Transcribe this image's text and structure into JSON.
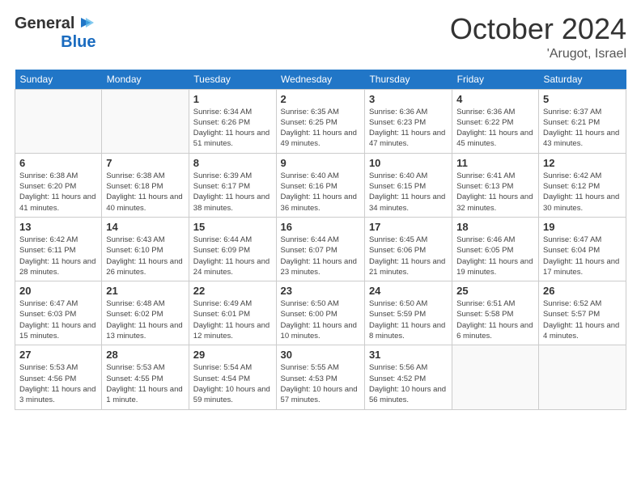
{
  "header": {
    "logo_general": "General",
    "logo_blue": "Blue",
    "month": "October 2024",
    "location": "'Arugot, Israel"
  },
  "days_of_week": [
    "Sunday",
    "Monday",
    "Tuesday",
    "Wednesday",
    "Thursday",
    "Friday",
    "Saturday"
  ],
  "weeks": [
    [
      {
        "day": "",
        "info": ""
      },
      {
        "day": "",
        "info": ""
      },
      {
        "day": "1",
        "info": "Sunrise: 6:34 AM\nSunset: 6:26 PM\nDaylight: 11 hours and 51 minutes."
      },
      {
        "day": "2",
        "info": "Sunrise: 6:35 AM\nSunset: 6:25 PM\nDaylight: 11 hours and 49 minutes."
      },
      {
        "day": "3",
        "info": "Sunrise: 6:36 AM\nSunset: 6:23 PM\nDaylight: 11 hours and 47 minutes."
      },
      {
        "day": "4",
        "info": "Sunrise: 6:36 AM\nSunset: 6:22 PM\nDaylight: 11 hours and 45 minutes."
      },
      {
        "day": "5",
        "info": "Sunrise: 6:37 AM\nSunset: 6:21 PM\nDaylight: 11 hours and 43 minutes."
      }
    ],
    [
      {
        "day": "6",
        "info": "Sunrise: 6:38 AM\nSunset: 6:20 PM\nDaylight: 11 hours and 41 minutes."
      },
      {
        "day": "7",
        "info": "Sunrise: 6:38 AM\nSunset: 6:18 PM\nDaylight: 11 hours and 40 minutes."
      },
      {
        "day": "8",
        "info": "Sunrise: 6:39 AM\nSunset: 6:17 PM\nDaylight: 11 hours and 38 minutes."
      },
      {
        "day": "9",
        "info": "Sunrise: 6:40 AM\nSunset: 6:16 PM\nDaylight: 11 hours and 36 minutes."
      },
      {
        "day": "10",
        "info": "Sunrise: 6:40 AM\nSunset: 6:15 PM\nDaylight: 11 hours and 34 minutes."
      },
      {
        "day": "11",
        "info": "Sunrise: 6:41 AM\nSunset: 6:13 PM\nDaylight: 11 hours and 32 minutes."
      },
      {
        "day": "12",
        "info": "Sunrise: 6:42 AM\nSunset: 6:12 PM\nDaylight: 11 hours and 30 minutes."
      }
    ],
    [
      {
        "day": "13",
        "info": "Sunrise: 6:42 AM\nSunset: 6:11 PM\nDaylight: 11 hours and 28 minutes."
      },
      {
        "day": "14",
        "info": "Sunrise: 6:43 AM\nSunset: 6:10 PM\nDaylight: 11 hours and 26 minutes."
      },
      {
        "day": "15",
        "info": "Sunrise: 6:44 AM\nSunset: 6:09 PM\nDaylight: 11 hours and 24 minutes."
      },
      {
        "day": "16",
        "info": "Sunrise: 6:44 AM\nSunset: 6:07 PM\nDaylight: 11 hours and 23 minutes."
      },
      {
        "day": "17",
        "info": "Sunrise: 6:45 AM\nSunset: 6:06 PM\nDaylight: 11 hours and 21 minutes."
      },
      {
        "day": "18",
        "info": "Sunrise: 6:46 AM\nSunset: 6:05 PM\nDaylight: 11 hours and 19 minutes."
      },
      {
        "day": "19",
        "info": "Sunrise: 6:47 AM\nSunset: 6:04 PM\nDaylight: 11 hours and 17 minutes."
      }
    ],
    [
      {
        "day": "20",
        "info": "Sunrise: 6:47 AM\nSunset: 6:03 PM\nDaylight: 11 hours and 15 minutes."
      },
      {
        "day": "21",
        "info": "Sunrise: 6:48 AM\nSunset: 6:02 PM\nDaylight: 11 hours and 13 minutes."
      },
      {
        "day": "22",
        "info": "Sunrise: 6:49 AM\nSunset: 6:01 PM\nDaylight: 11 hours and 12 minutes."
      },
      {
        "day": "23",
        "info": "Sunrise: 6:50 AM\nSunset: 6:00 PM\nDaylight: 11 hours and 10 minutes."
      },
      {
        "day": "24",
        "info": "Sunrise: 6:50 AM\nSunset: 5:59 PM\nDaylight: 11 hours and 8 minutes."
      },
      {
        "day": "25",
        "info": "Sunrise: 6:51 AM\nSunset: 5:58 PM\nDaylight: 11 hours and 6 minutes."
      },
      {
        "day": "26",
        "info": "Sunrise: 6:52 AM\nSunset: 5:57 PM\nDaylight: 11 hours and 4 minutes."
      }
    ],
    [
      {
        "day": "27",
        "info": "Sunrise: 5:53 AM\nSunset: 4:56 PM\nDaylight: 11 hours and 3 minutes."
      },
      {
        "day": "28",
        "info": "Sunrise: 5:53 AM\nSunset: 4:55 PM\nDaylight: 11 hours and 1 minute."
      },
      {
        "day": "29",
        "info": "Sunrise: 5:54 AM\nSunset: 4:54 PM\nDaylight: 10 hours and 59 minutes."
      },
      {
        "day": "30",
        "info": "Sunrise: 5:55 AM\nSunset: 4:53 PM\nDaylight: 10 hours and 57 minutes."
      },
      {
        "day": "31",
        "info": "Sunrise: 5:56 AM\nSunset: 4:52 PM\nDaylight: 10 hours and 56 minutes."
      },
      {
        "day": "",
        "info": ""
      },
      {
        "day": "",
        "info": ""
      }
    ]
  ]
}
